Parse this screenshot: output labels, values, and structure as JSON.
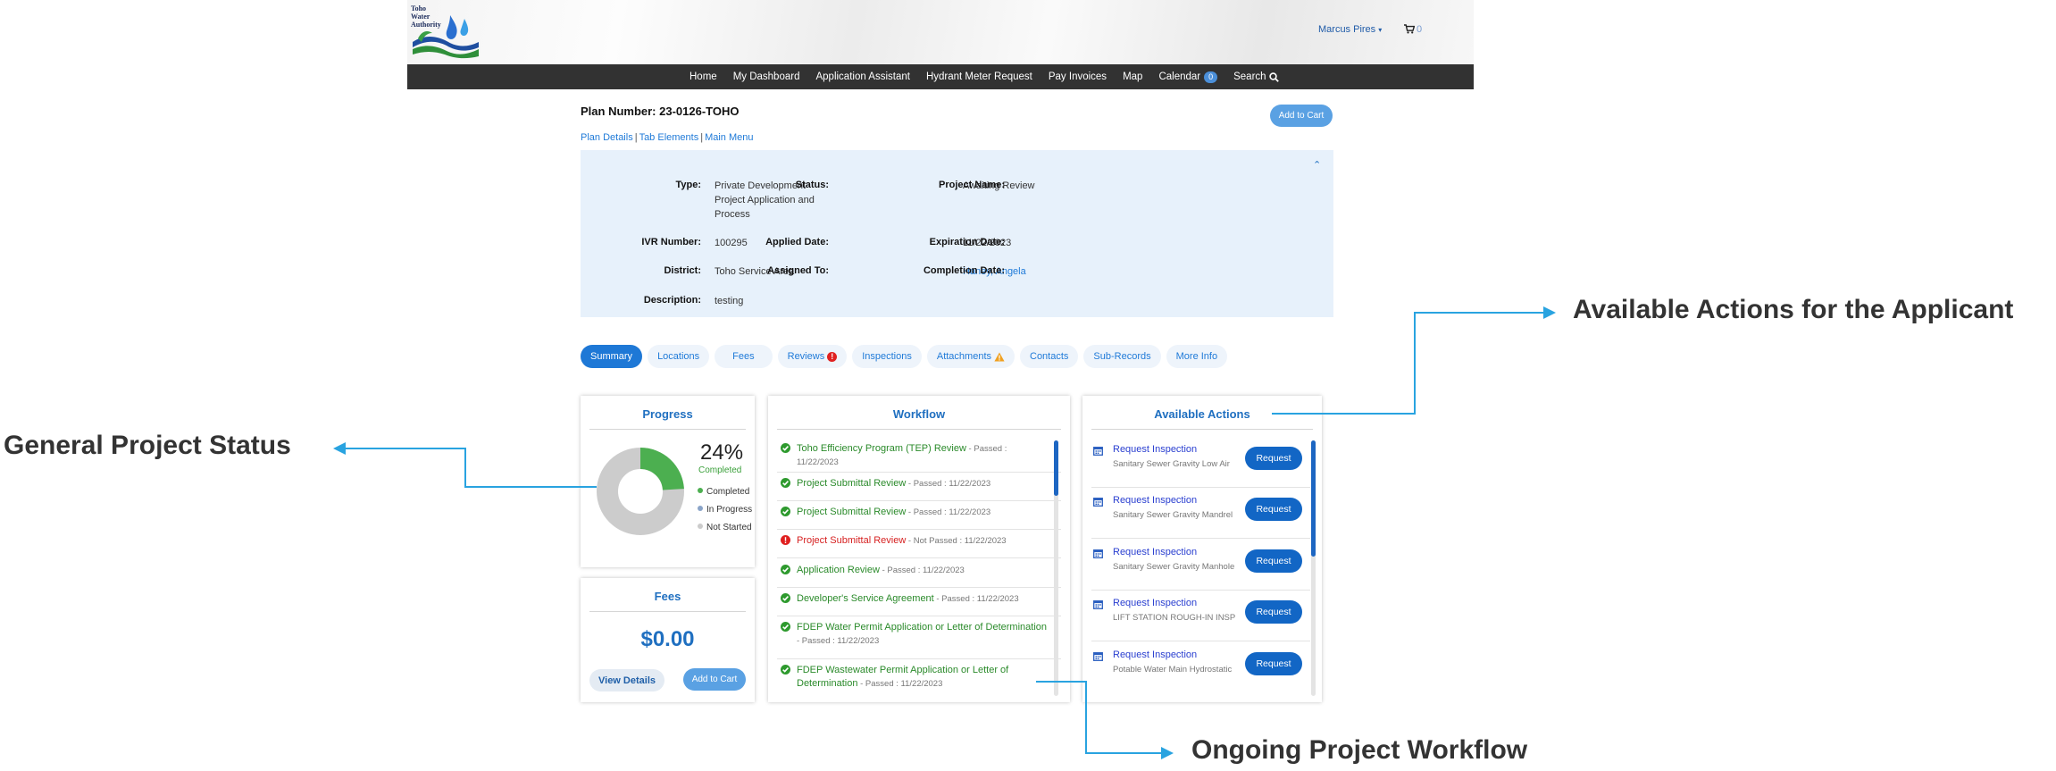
{
  "header": {
    "logo_text": "Toho Water Authority",
    "user_name": "Marcus Pires",
    "cart_count": "0"
  },
  "nav": {
    "items": [
      "Home",
      "My Dashboard",
      "Application Assistant",
      "Hydrant Meter Request",
      "Pay Invoices",
      "Map",
      "Calendar",
      "Search"
    ],
    "calendar_badge": "0"
  },
  "plan": {
    "number_label": "Plan Number: 23-0126-TOHO",
    "add_to_cart": "Add to Cart",
    "links": [
      "Plan Details",
      "Tab Elements",
      "Main Menu"
    ],
    "link_sep": "|"
  },
  "info": {
    "type_label": "Type:",
    "type_value": "Private Development Project Application and Process",
    "status_label": "Status:",
    "status_value": "Awaiting Review",
    "project_name_label": "Project Name:",
    "ivr_label": "IVR Number:",
    "ivr_value": "100295",
    "applied_label": "Applied Date:",
    "applied_value": "11/22/2023",
    "expiration_label": "Expiration Date:",
    "district_label": "District:",
    "district_value": "Toho Service Area",
    "assigned_label": "Assigned To:",
    "assigned_value": "Haney, Angela",
    "completion_label": "Completion Date:",
    "description_label": "Description:",
    "description_value": "testing"
  },
  "tabs": [
    "Summary",
    "Locations",
    "Fees",
    "Reviews",
    "Inspections",
    "Attachments",
    "Contacts",
    "Sub-Records",
    "More Info"
  ],
  "progress": {
    "title": "Progress",
    "percent_text": "24%",
    "percent_caption": "Completed",
    "completed_fraction": 0.24,
    "legend": [
      "Completed",
      "In Progress",
      "Not Started"
    ],
    "colors": {
      "completed": "#4caf50",
      "in_progress": "#8aa4c8",
      "not_started": "#cccccc"
    }
  },
  "fees": {
    "title": "Fees",
    "amount": "$0.00",
    "view_details": "View Details",
    "add_to_cart": "Add to Cart"
  },
  "workflow": {
    "title": "Workflow",
    "items": [
      {
        "name": "Toho Efficiency Program (TEP) Review",
        "meta": " - Passed : 11/22/2023",
        "status": "passed"
      },
      {
        "name": "Project Submittal Review",
        "meta": " - Passed : 11/22/2023",
        "status": "passed"
      },
      {
        "name": "Project Submittal Review",
        "meta": " - Passed : 11/22/2023",
        "status": "passed"
      },
      {
        "name": "Project Submittal Review",
        "meta": " - Not Passed : 11/22/2023",
        "status": "failed"
      },
      {
        "name": "Application Review",
        "meta": " - Passed : 11/22/2023",
        "status": "passed"
      },
      {
        "name": "Developer's Service Agreement",
        "meta": " - Passed : 11/22/2023",
        "status": "passed"
      },
      {
        "name": "FDEP Water Permit Application or Letter of Determination",
        "meta": " - Passed : 11/22/2023",
        "status": "passed"
      },
      {
        "name": "FDEP Wastewater Permit Application or Letter of Determination",
        "meta": " - Passed : 11/22/2023",
        "status": "passed"
      }
    ]
  },
  "actions": {
    "title": "Available Actions",
    "request_label": "Request",
    "items": [
      {
        "title": "Request Inspection",
        "sub": "Sanitary Sewer Gravity Low Air"
      },
      {
        "title": "Request Inspection",
        "sub": "Sanitary Sewer Gravity Mandrel"
      },
      {
        "title": "Request Inspection",
        "sub": "Sanitary Sewer Gravity Manhole"
      },
      {
        "title": "Request Inspection",
        "sub": "LIFT STATION ROUGH-IN INSP"
      },
      {
        "title": "Request Inspection",
        "sub": "Potable Water Main Hydrostatic"
      }
    ]
  },
  "annotations": {
    "applicant": "Available Actions for the Applicant",
    "status": "General Project Status",
    "workflow": "Ongoing Project Workflow",
    "arrow_color": "#29a3e0"
  }
}
